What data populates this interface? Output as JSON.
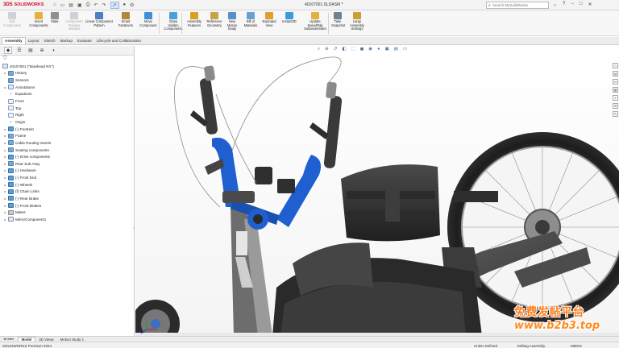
{
  "app": {
    "logo_mark": "3DS",
    "logo_text": "SOLIDWORKS",
    "document_title": "40107001.SLDASM *",
    "search_placeholder": "Search MySolidWorks"
  },
  "ribbon": {
    "buttons": [
      {
        "label": "Edit\nComponent",
        "enabled": false,
        "color": "#9aa7b8"
      },
      {
        "label": "Insert\nComponents",
        "enabled": true,
        "color": "#e8b33a"
      },
      {
        "label": "Mate",
        "enabled": true,
        "color": "#8f8f8f"
      },
      {
        "label": "Component\nPreview\nWindow",
        "enabled": false,
        "color": "#9aa7b8"
      },
      {
        "label": "Linear Component\nPattern",
        "enabled": true,
        "color": "#4d7fc0"
      },
      {
        "label": "Smart\nFasteners",
        "enabled": true,
        "color": "#b0873c"
      },
      {
        "label": "Move\nComponent",
        "enabled": true,
        "color": "#3f8fd8"
      },
      {
        "label": "Show\nHidden\nComponents",
        "enabled": true,
        "color": "#4aa0d8"
      },
      {
        "label": "Assembly\nFeatures",
        "enabled": true,
        "color": "#d6a024"
      },
      {
        "label": "Reference\nGeometry",
        "enabled": true,
        "color": "#c9a24a"
      },
      {
        "label": "New\nMotion\nStudy",
        "enabled": true,
        "color": "#5b8fc9"
      },
      {
        "label": "Bill of\nMaterials",
        "enabled": true,
        "color": "#6aa0cf"
      },
      {
        "label": "Exploded\nView",
        "enabled": true,
        "color": "#e0a030"
      },
      {
        "label": "Instant3D",
        "enabled": true,
        "color": "#3e9bdb"
      },
      {
        "label": "Update\nSpeedPak\nSubassemblies",
        "enabled": true,
        "color": "#e0b040"
      },
      {
        "label": "Take\nSnapshot",
        "enabled": true,
        "color": "#708090"
      },
      {
        "label": "Large\nAssembly\nSettings",
        "enabled": true,
        "color": "#c9a033"
      }
    ]
  },
  "command_tabs": [
    "Assembly",
    "Layout",
    "Sketch",
    "Markup",
    "Evaluate",
    "Lifecycle and Collaboration"
  ],
  "panel_tabs": [
    {
      "icon": "feature-manager-icon",
      "glyph": "◆"
    },
    {
      "icon": "property-manager-icon",
      "glyph": "☰"
    },
    {
      "icon": "configuration-manager-icon",
      "glyph": "▤"
    },
    {
      "icon": "dimxpert-manager-icon",
      "glyph": "⊕"
    },
    {
      "icon": "display-manager-icon",
      "glyph": "◑"
    }
  ],
  "tree": {
    "root": "40107001 (\"Bowhead RX\")",
    "items": [
      {
        "label": "History",
        "icon": "folder",
        "expandable": true
      },
      {
        "label": "Sensors",
        "icon": "folder",
        "expandable": false
      },
      {
        "label": "Annotations",
        "icon": "asm",
        "expandable": true
      },
      {
        "label": "Equations",
        "icon": "plain",
        "expandable": false
      },
      {
        "label": "Front",
        "icon": "plane",
        "expandable": false
      },
      {
        "label": "Top",
        "icon": "plane",
        "expandable": false
      },
      {
        "label": "Right",
        "icon": "plane",
        "expandable": false
      },
      {
        "label": "Origin",
        "icon": "plain",
        "expandable": false
      },
      {
        "label": "(-) Footrest",
        "icon": "comp",
        "expandable": true
      },
      {
        "label": "Frame",
        "icon": "folder",
        "expandable": true
      },
      {
        "label": "Cable Routing Inserts",
        "icon": "folder",
        "expandable": true
      },
      {
        "label": "Seating components",
        "icon": "folder",
        "expandable": true
      },
      {
        "label": "(-) Drive components",
        "icon": "comp",
        "expandable": true
      },
      {
        "label": "Rear Sub Assy",
        "icon": "folder",
        "expandable": true
      },
      {
        "label": "(-) Hardware",
        "icon": "comp",
        "expandable": true
      },
      {
        "label": "(-) Front End",
        "icon": "comp",
        "expandable": true
      },
      {
        "label": "(-) Wheels",
        "icon": "comp",
        "expandable": true
      },
      {
        "label": "(f) Chain Links",
        "icon": "comp",
        "expandable": true
      },
      {
        "label": "(-) Rear Brake",
        "icon": "comp",
        "expandable": true
      },
      {
        "label": "(-) Front Brakes",
        "icon": "comp",
        "expandable": true
      },
      {
        "label": "Mates",
        "icon": "mates",
        "expandable": true
      },
      {
        "label": "MirrorComponent1",
        "icon": "asm",
        "expandable": true
      }
    ]
  },
  "bottom_tabs": [
    "Model",
    "3D Views",
    "Motion Study 1"
  ],
  "status": {
    "product": "SOLIDWORKS Premium 2024",
    "state": "Under Defined",
    "mode": "Editing Assembly",
    "units": "MMGS"
  },
  "watermark": {
    "cn": "免费发帖平台",
    "url": "www.b2b3.top"
  }
}
